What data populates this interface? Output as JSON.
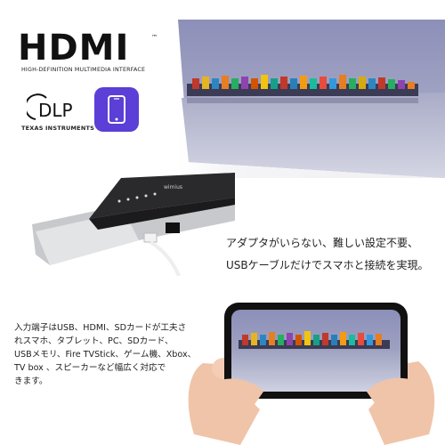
{
  "hdmi": {
    "logo_text": "HDMI",
    "trademark": "™",
    "subtitle": "HIGH-DEFINITION MULTIMEDIA INTERFACE"
  },
  "dlp": {
    "logo_text": "DLP",
    "subtitle": "TEXAS INSTRUMENTS"
  },
  "app_icon": {
    "icon": "smartphone-icon",
    "color": "#5b3fd6"
  },
  "device": {
    "brand": "wimius"
  },
  "headline": {
    "line1": "アダプタがいらない、難しい設定不要、",
    "line2": "USBケーブルだけでスマホと接続を実現。"
  },
  "description": {
    "lines": [
      "入力端子はUSB、HDMI、SDカードが工夫さ",
      "れスマホ、タブレット、PC、SDカード、",
      "USBメモリ、Fire TVStick、ゲーム機、Xbox、",
      "TV box 、スピーカーなど幅広く対応で",
      "きます。"
    ]
  },
  "colors": {
    "accent_purple": "#5b3fd6",
    "sky": "#9aa0c8",
    "water": "#c9cde0"
  }
}
